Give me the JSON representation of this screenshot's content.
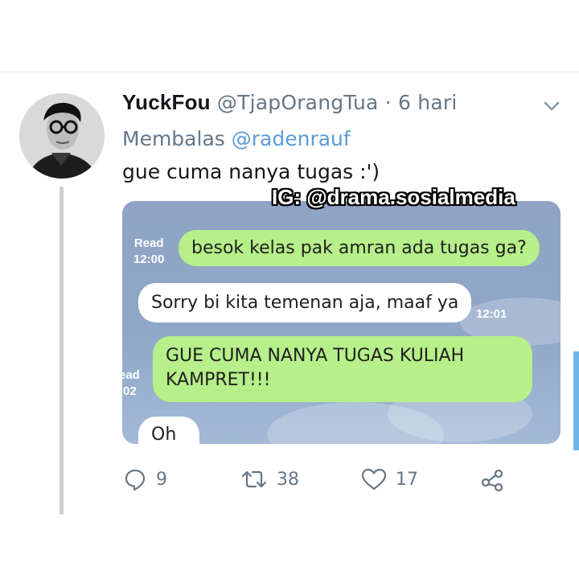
{
  "tweet": {
    "display_name": "YuckFou",
    "handle": "@TjapOrangTua",
    "separator": "·",
    "time": "6 hari",
    "reply_prefix": "Membalas",
    "reply_to": "@radenrauf",
    "text": "gue cuma nanya tugas :')"
  },
  "watermark": "IG: @drama.sosialmedia",
  "chat": {
    "messages": [
      {
        "side": "out",
        "text": "besok kelas pak amran ada tugas ga?",
        "status": "Read",
        "time": "12:00"
      },
      {
        "side": "in",
        "text": "Sorry bi kita temenan aja, maaf ya",
        "time": "12:01"
      },
      {
        "side": "out",
        "text_lines": [
          "GUE CUMA NANYA TUGAS KULIAH",
          "KAMPRET!!!"
        ],
        "status": "ead",
        "time": ":02"
      },
      {
        "side": "in",
        "text": "Oh"
      }
    ]
  },
  "actions": {
    "reply_count": "9",
    "retweet_count": "38",
    "like_count": "17",
    "reply_icon": "reply-icon",
    "retweet_icon": "retweet-icon",
    "like_icon": "heart-icon",
    "share_icon": "share-icon"
  },
  "colors": {
    "chat_outgoing": "#b7ef8a",
    "chat_incoming": "#ffffff",
    "chat_background": "#90a7c8",
    "link": "#5a9bd8",
    "muted_text": "#657786"
  }
}
